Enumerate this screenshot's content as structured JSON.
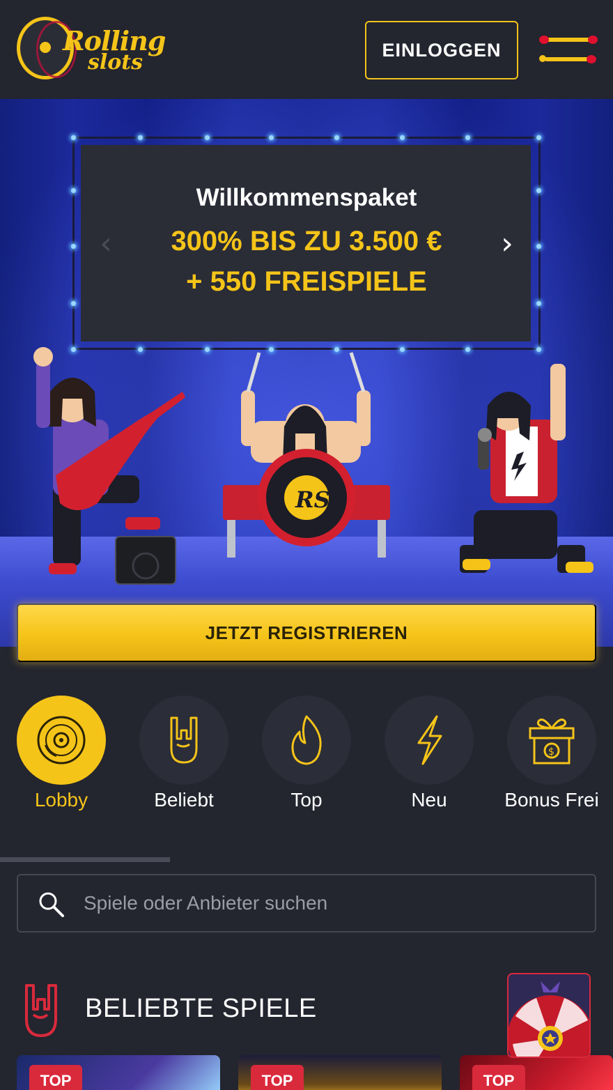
{
  "header": {
    "logo_line1": "Rolling",
    "logo_line2": "slots",
    "login_label": "EINLOGGEN",
    "menu_icon": "hamburger-drumsticks-icon"
  },
  "banner": {
    "title": "Willkommenspaket",
    "line1": "300% BIS ZU 3.500 €",
    "line2": "+ 550 FREISPIELE",
    "prev_icon": "chevron-left-icon",
    "next_icon": "chevron-right-icon",
    "register_label": "JETZT REGISTRIEREN"
  },
  "categories": [
    {
      "label": "Lobby",
      "icon": "vinyl-disc-icon",
      "active": true
    },
    {
      "label": "Beliebt",
      "icon": "rock-hand-icon",
      "active": false
    },
    {
      "label": "Top",
      "icon": "flame-icon",
      "active": false
    },
    {
      "label": "Neu",
      "icon": "lightning-icon",
      "active": false
    },
    {
      "label": "Bonus Frei",
      "icon": "gift-icon",
      "active": false
    }
  ],
  "search": {
    "placeholder": "Spiele oder Anbieter suchen"
  },
  "popular": {
    "title": "BELIEBTE SPIELE",
    "games": [
      {
        "badge": "TOP"
      },
      {
        "badge": "TOP"
      },
      {
        "badge": "TOP"
      }
    ]
  },
  "colors": {
    "background": "#23252f",
    "accent": "#f5c419",
    "badge": "#d92a3c"
  }
}
